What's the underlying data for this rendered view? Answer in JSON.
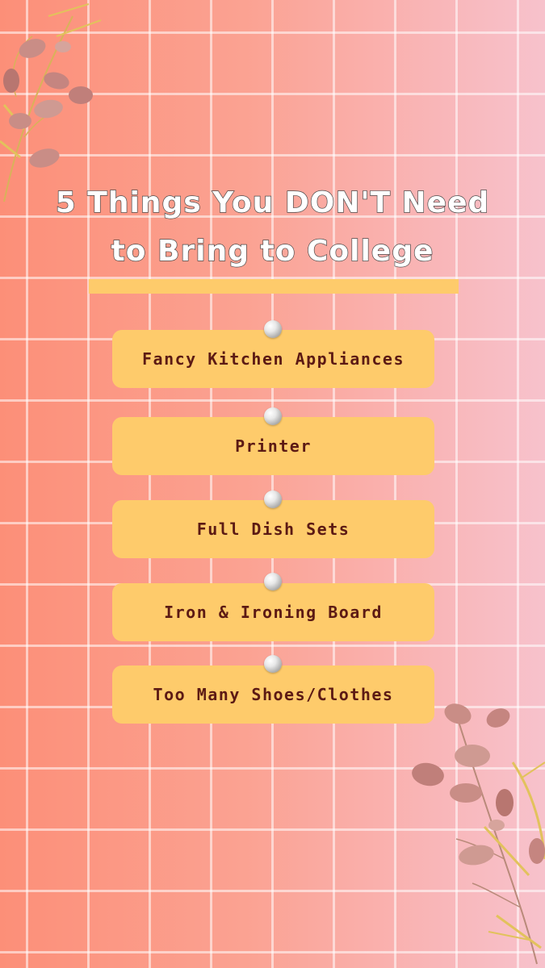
{
  "title": {
    "line1": "5 Things You DON'T Need",
    "line2": "to Bring to College"
  },
  "items": [
    {
      "label": "Fancy Kitchen Appliances"
    },
    {
      "label": "Printer"
    },
    {
      "label": "Full Dish Sets"
    },
    {
      "label": "Iron & Ironing Board"
    },
    {
      "label": "Too Many Shoes/Clothes"
    }
  ],
  "colors": {
    "accent": "#fecb6b",
    "label_text": "#5c1a14",
    "background_start": "#fc8f78",
    "background_end": "#f7c2cc"
  },
  "decorations": [
    "leaf-sprig-top-left",
    "leaf-sprig-bottom-right"
  ]
}
